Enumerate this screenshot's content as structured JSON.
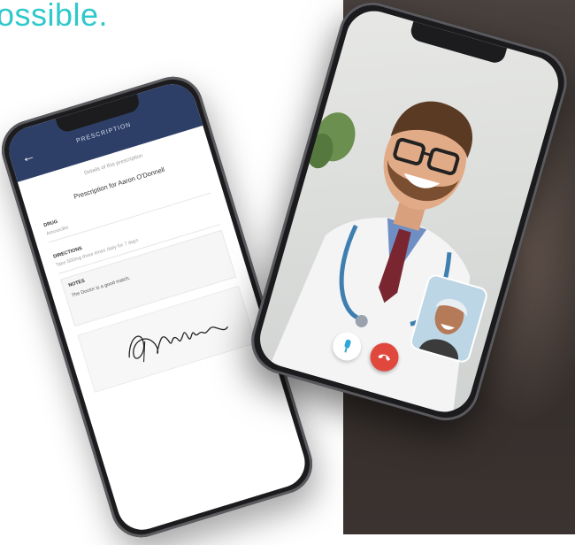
{
  "headline": "ossible.",
  "prescription_app": {
    "title": "PRESCRIPTION",
    "subtitle": "Details of this prescription",
    "heading": "Prescription for Aaron O'Donnell",
    "fields": [
      {
        "label": "DRUG",
        "value": "Amoxicillin"
      },
      {
        "label": "DIRECTIONS",
        "value": "Take 500mg three times daily for 7 days"
      }
    ],
    "notes_label": "NOTES",
    "notes_text": "The Doctor is a good match."
  },
  "video_call": {
    "controls": [
      "mic-icon",
      "end-call-icon"
    ]
  },
  "colors": {
    "headline": "#2fc8cc",
    "app_bar": "#2d3f66",
    "end_call": "#e0483d"
  }
}
